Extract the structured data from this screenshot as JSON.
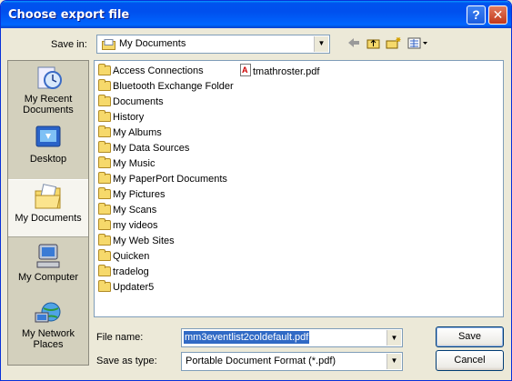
{
  "window": {
    "title": "Choose export file"
  },
  "titlebar": {
    "help_label": "?",
    "close_label": "✕"
  },
  "toolbar": {
    "save_in_label": "Save in:",
    "location": "My Documents"
  },
  "places": [
    {
      "label": "My Recent Documents",
      "icon": "recent-documents-icon"
    },
    {
      "label": "Desktop",
      "icon": "desktop-icon"
    },
    {
      "label": "My Documents",
      "icon": "my-documents-icon",
      "selected": true
    },
    {
      "label": "My Computer",
      "icon": "my-computer-icon"
    },
    {
      "label": "My Network Places",
      "icon": "network-places-icon"
    }
  ],
  "files": {
    "col1": [
      {
        "name": "Access Connections",
        "icon": "folder-icon"
      },
      {
        "name": "Bluetooth Exchange Folder",
        "icon": "folder-icon"
      },
      {
        "name": "Documents",
        "icon": "folder-icon"
      },
      {
        "name": "History",
        "icon": "folder-icon"
      },
      {
        "name": "My Albums",
        "icon": "folder-icon"
      },
      {
        "name": "My Data Sources",
        "icon": "data-sources-folder-icon"
      },
      {
        "name": "My Music",
        "icon": "music-folder-icon"
      },
      {
        "name": "My PaperPort Documents",
        "icon": "folder-icon"
      },
      {
        "name": "My Pictures",
        "icon": "pictures-folder-icon"
      },
      {
        "name": "My Scans",
        "icon": "folder-icon"
      },
      {
        "name": "my videos",
        "icon": "folder-icon"
      },
      {
        "name": "My Web Sites",
        "icon": "web-sites-folder-icon"
      },
      {
        "name": "Quicken",
        "icon": "folder-icon"
      },
      {
        "name": "tradelog",
        "icon": "folder-icon"
      },
      {
        "name": "Updater5",
        "icon": "folder-icon"
      }
    ],
    "col2": [
      {
        "name": "tmathroster.pdf",
        "icon": "pdf-file-icon"
      }
    ]
  },
  "form": {
    "filename_label": "File name:",
    "filename_value": "mm3eventlist2coldefault.pdf",
    "filetype_label": "Save as type:",
    "filetype_value": "Portable Document Format (*.pdf)"
  },
  "buttons": {
    "save": "Save",
    "cancel": "Cancel"
  }
}
